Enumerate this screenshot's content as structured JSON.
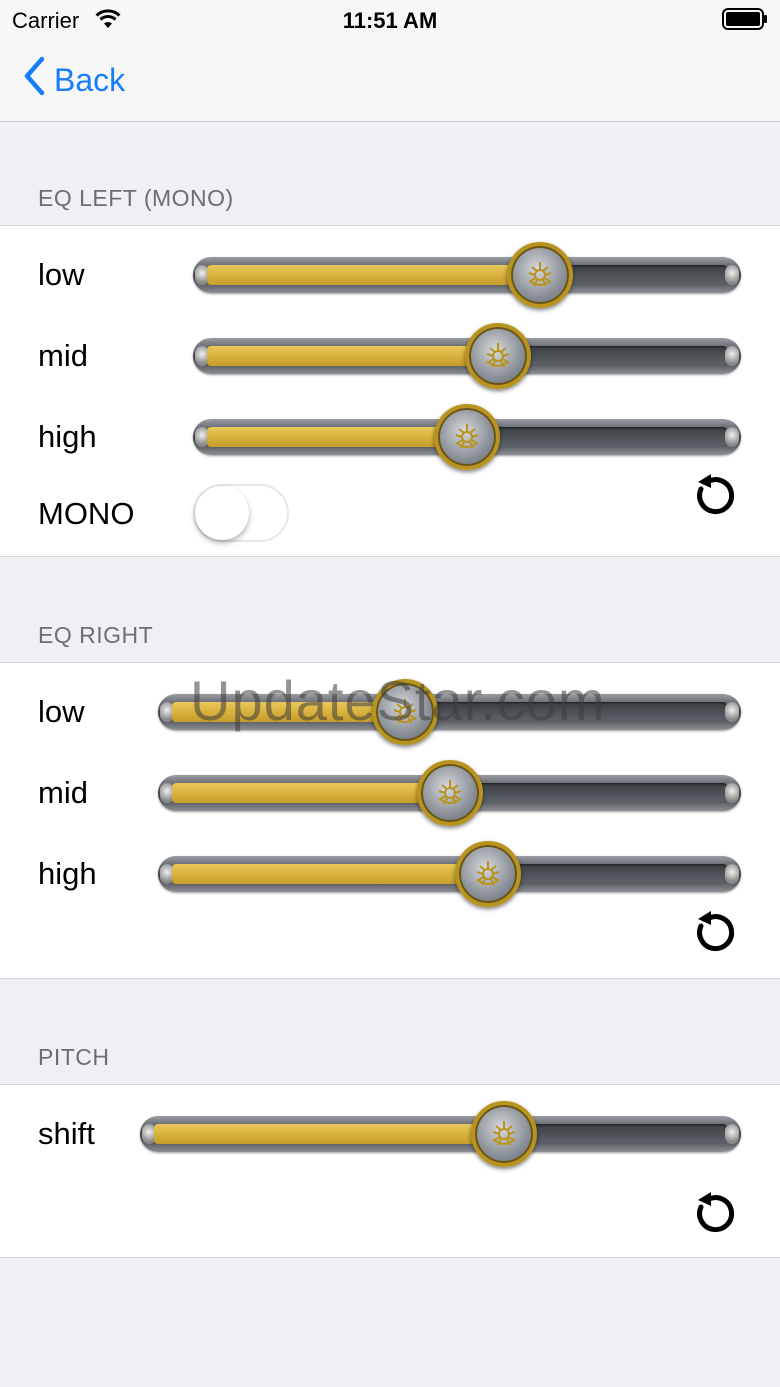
{
  "status_bar": {
    "carrier": "Carrier",
    "time": "11:51 AM"
  },
  "nav": {
    "back_label": "Back"
  },
  "sections": {
    "eq_left": {
      "header": "EQ LEFT (MONO)",
      "sliders": [
        {
          "label": "low",
          "value": 0.64
        },
        {
          "label": "mid",
          "value": 0.56
        },
        {
          "label": "high",
          "value": 0.5
        }
      ],
      "toggle_label": "MONO",
      "toggle_on": false
    },
    "eq_right": {
      "header": "EQ RIGHT",
      "sliders": [
        {
          "label": "low",
          "value": 0.42
        },
        {
          "label": "mid",
          "value": 0.5
        },
        {
          "label": "high",
          "value": 0.57
        }
      ]
    },
    "pitch": {
      "header": "PITCH",
      "sliders": [
        {
          "label": "shift",
          "value": 0.61
        }
      ]
    }
  },
  "watermark": "UpdateStar.com",
  "colors": {
    "accent": "#157efb",
    "fill": "#d9b23e",
    "thumb_ring": "#b8941f"
  },
  "icons": {
    "back": "chevron-left-icon",
    "reset": "reset-icon",
    "wifi": "wifi-icon",
    "battery": "battery-icon"
  }
}
